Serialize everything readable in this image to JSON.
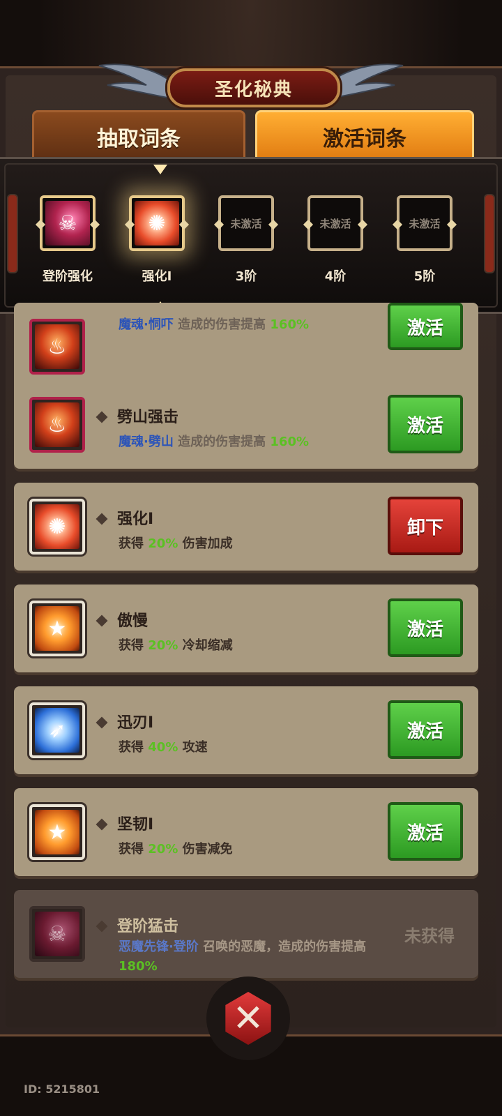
{
  "title": "圣化秘典",
  "tabs": {
    "draw": "抽取词条",
    "activate": "激活词条"
  },
  "tiers": [
    {
      "label": "登阶强化",
      "slot_text": "",
      "icon": "demon-icon"
    },
    {
      "label": "强化I",
      "slot_text": "",
      "icon": "flame-burst-icon"
    },
    {
      "label": "3阶",
      "slot_text": "未激活",
      "icon": "locked-slot"
    },
    {
      "label": "4阶",
      "slot_text": "未激活",
      "icon": "locked-slot"
    },
    {
      "label": "5阶",
      "slot_text": "未激活",
      "icon": "locked-slot"
    }
  ],
  "cards": [
    {
      "name": "",
      "desc_a": "魔魂·恫吓",
      "desc_b": " 造成的伤害提高 ",
      "desc_c": "160%",
      "button": "激活",
      "icon": "lava-demon-icon"
    },
    {
      "name": "劈山强击",
      "desc_a": "魔魂·劈山",
      "desc_b": " 造成的伤害提高 ",
      "desc_c": "160%",
      "button": "激活",
      "icon": "lava-demon-icon"
    },
    {
      "name": "强化I",
      "desc_a": "获得 ",
      "desc_b": "20%",
      "desc_c": " 伤害加成",
      "button": "卸下",
      "icon": "flame-burst-icon"
    },
    {
      "name": "傲慢",
      "desc_a": "获得 ",
      "desc_b": "20%",
      "desc_c": " 冷却缩减",
      "button": "激活",
      "icon": "star-shield-icon"
    },
    {
      "name": "迅刃I",
      "desc_a": "获得 ",
      "desc_b": "40%",
      "desc_c": " 攻速",
      "button": "激活",
      "icon": "blue-blade-icon"
    },
    {
      "name": "坚韧I",
      "desc_a": "获得 ",
      "desc_b": "20%",
      "desc_c": " 伤害减免",
      "button": "激活",
      "icon": "star-shield-icon"
    },
    {
      "name": "登阶猛击",
      "desc_a": "恶魔先锋·登阶",
      "desc_b": " 召唤的恶魔，造成的伤害提高 ",
      "desc_c": "180%",
      "status": "未获得",
      "icon": "demon-icon"
    }
  ],
  "footer": {
    "id": "ID: 5215801"
  }
}
